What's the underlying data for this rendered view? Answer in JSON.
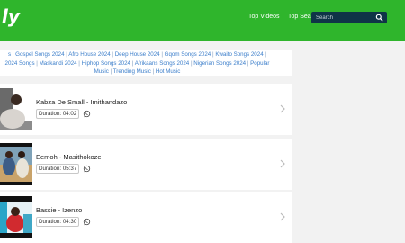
{
  "header": {
    "logo": "ly",
    "nav": [
      "Top Videos",
      "Top Searches"
    ],
    "search_placeholder": "Search"
  },
  "tags": {
    "lines": [
      [
        "s",
        "Gospel Songs 2024",
        "Afro House 2024",
        "Deep House 2024",
        "Gqom Songs 2024",
        "Kwaito Songs 2024",
        ""
      ],
      [
        "2024 Songs",
        "Maskandi 2024",
        "Hiphop Songs 2024",
        "Afrikaans Songs 2024",
        "Nigerian Songs 2024",
        "Popular"
      ],
      [
        "Music",
        "Trending Music",
        "Hot Music"
      ]
    ]
  },
  "songs": [
    {
      "title": "Kabza De Small - Imithandazo",
      "duration": "Duration: 04:02"
    },
    {
      "title": "Eemoh - Masithokoze",
      "duration": "Duration: 05:37"
    },
    {
      "title": "Bassie - Izenzo",
      "duration": "Duration: 04:30"
    }
  ],
  "colors": {
    "header": "#2fb52c",
    "search_bg": "#0f3447",
    "link": "#3a7dca"
  }
}
